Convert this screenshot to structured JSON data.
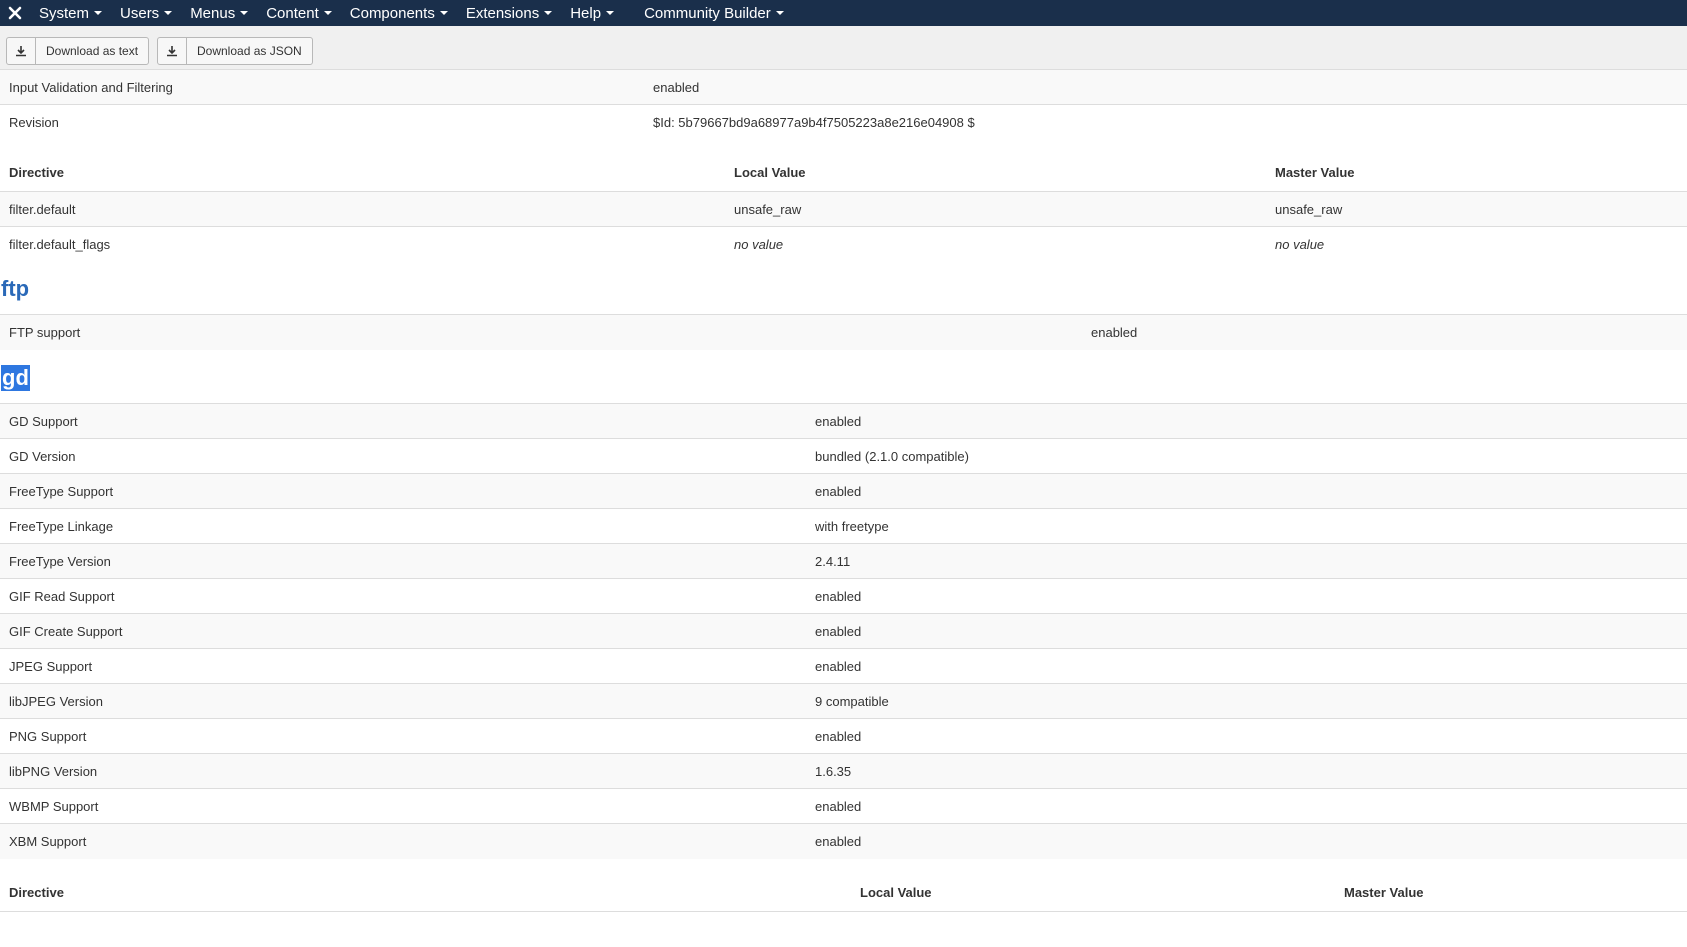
{
  "nav": {
    "items": [
      "System",
      "Users",
      "Menus",
      "Content",
      "Components",
      "Extensions",
      "Help"
    ],
    "community_builder": "Community Builder"
  },
  "toolbar": {
    "download_text": "Download as text",
    "download_json": "Download as JSON"
  },
  "filter_info": [
    {
      "label": "Input Validation and Filtering",
      "value": "enabled"
    },
    {
      "label": "Revision",
      "value": "$Id: 5b79667bd9a68977a9b4f7505223a8e216e04908 $"
    }
  ],
  "filter_directives": {
    "headers": [
      "Directive",
      "Local Value",
      "Master Value"
    ],
    "rows": [
      {
        "directive": "filter.default",
        "local": "unsafe_raw",
        "master": "unsafe_raw"
      },
      {
        "directive": "filter.default_flags",
        "local": "no value",
        "master": "no value"
      }
    ]
  },
  "ftp": {
    "title": "ftp",
    "rows": [
      {
        "label": "FTP support",
        "value": "enabled"
      }
    ]
  },
  "gd": {
    "title": "gd",
    "rows": [
      {
        "label": "GD Support",
        "value": "enabled"
      },
      {
        "label": "GD Version",
        "value": "bundled (2.1.0 compatible)"
      },
      {
        "label": "FreeType Support",
        "value": "enabled"
      },
      {
        "label": "FreeType Linkage",
        "value": "with freetype"
      },
      {
        "label": "FreeType Version",
        "value": "2.4.11"
      },
      {
        "label": "GIF Read Support",
        "value": "enabled"
      },
      {
        "label": "GIF Create Support",
        "value": "enabled"
      },
      {
        "label": "JPEG Support",
        "value": "enabled"
      },
      {
        "label": "libJPEG Version",
        "value": "9 compatible"
      },
      {
        "label": "PNG Support",
        "value": "enabled"
      },
      {
        "label": "libPNG Version",
        "value": "1.6.35"
      },
      {
        "label": "WBMP Support",
        "value": "enabled"
      },
      {
        "label": "XBM Support",
        "value": "enabled"
      }
    ],
    "directive_headers": [
      "Directive",
      "Local Value",
      "Master Value"
    ]
  }
}
